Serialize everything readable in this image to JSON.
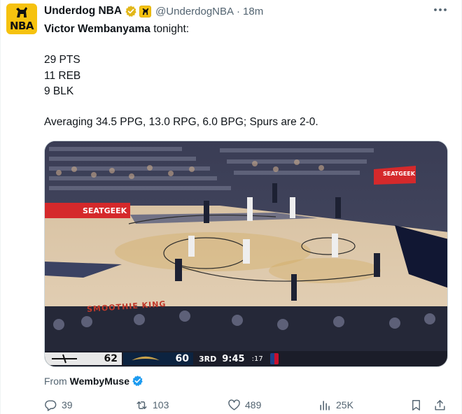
{
  "author": {
    "name": "Underdog NBA",
    "handle": "@UnderdogNBA",
    "separator": "·",
    "time": "18m",
    "avatar_text": "NBA"
  },
  "tweet": {
    "player_name": "Victor Wembanyama",
    "intro_rest": " tonight:",
    "stat_pts": "29 PTS",
    "stat_reb": "11 REB",
    "stat_blk": "9 BLK",
    "summary": "Averaging 34.5 PPG, 13.0 RPG, 6.0 BPG; Spurs are 2-0."
  },
  "media": {
    "court_ad_left": "SEATGEEK",
    "court_ad_right": "SEATGEEK",
    "court_text": "SMOOTHIE KING",
    "scorebug": {
      "away_score": "62",
      "home_score": "60",
      "quarter": "3RD",
      "clock": "9:45",
      "shot_clock": ":17"
    }
  },
  "source": {
    "prefix": "From",
    "name": "WembyMuse"
  },
  "actions": {
    "replies": "39",
    "reposts": "103",
    "likes": "489",
    "views": "25K"
  },
  "colors": {
    "accent": "#1d9bf0",
    "brand": "#f6c20f",
    "secondary_text": "#536471"
  },
  "icons": [
    "more-icon",
    "verified-gold-icon",
    "affiliate-badge-icon",
    "verified-blue-icon",
    "reply-icon",
    "repost-icon",
    "like-icon",
    "views-icon",
    "bookmark-icon",
    "share-icon"
  ]
}
